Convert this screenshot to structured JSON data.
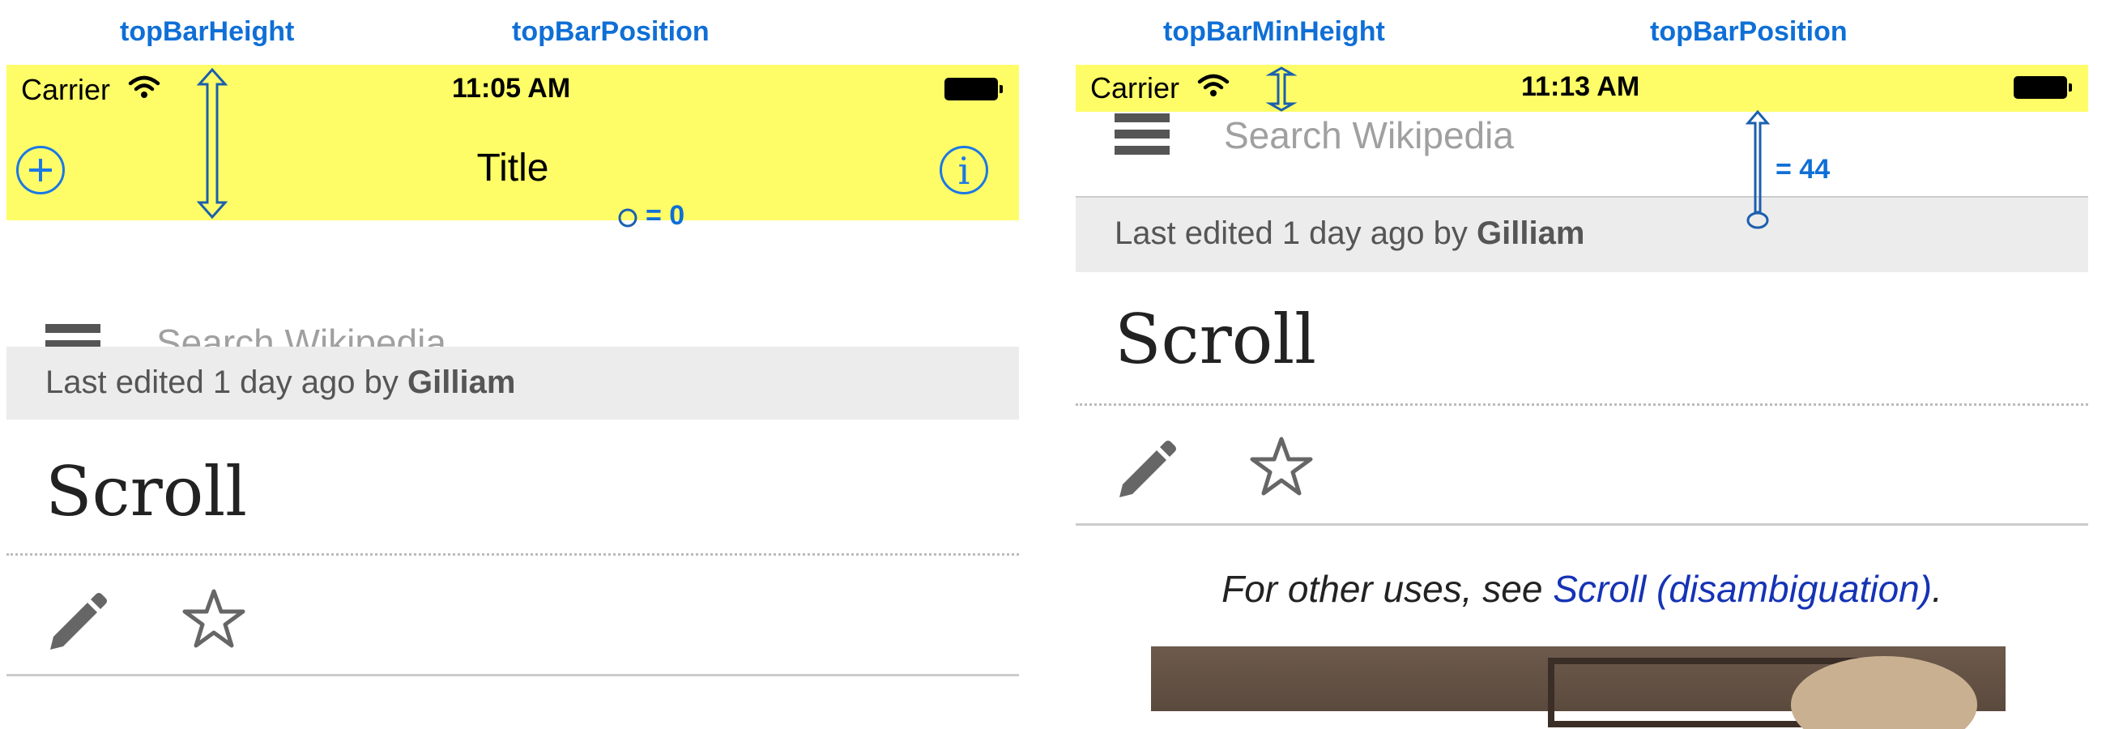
{
  "annotations": {
    "left": {
      "label_height": "topBarHeight",
      "label_position": "topBarPosition",
      "position_value": "= 0"
    },
    "right": {
      "label_height": "topBarMinHeight",
      "label_position": "topBarPosition",
      "position_value": "= 44"
    }
  },
  "colors": {
    "top_bar": "#fefd67",
    "annotation": "#0f6fd6",
    "nav_icon": "#1b78e6",
    "link": "#1533b5",
    "last_edited_bg": "#ececec"
  },
  "left_screen": {
    "status": {
      "carrier": "Carrier",
      "time": "11:05 AM",
      "wifi_icon": "wifi-icon",
      "battery_icon": "battery-icon"
    },
    "nav": {
      "title": "Title",
      "left_icon": "plus-circle-icon",
      "right_icon": "info-circle-icon"
    },
    "search": {
      "menu_icon": "hamburger-icon",
      "placeholder": "Search Wikipedia"
    },
    "last_edited": {
      "prefix": "Last edited 1 day ago by",
      "user": "Gilliam"
    },
    "page_title": "Scroll",
    "actions": {
      "edit_icon": "pencil-icon",
      "star_icon": "star-icon"
    }
  },
  "right_screen": {
    "status": {
      "carrier": "Carrier",
      "time": "11:13 AM",
      "wifi_icon": "wifi-icon",
      "battery_icon": "battery-icon"
    },
    "search": {
      "menu_icon": "hamburger-icon",
      "placeholder": "Search Wikipedia"
    },
    "last_edited": {
      "prefix": "Last edited 1 day ago by",
      "user": "Gilliam"
    },
    "page_title": "Scroll",
    "actions": {
      "edit_icon": "pencil-icon",
      "star_icon": "star-icon"
    },
    "hatnote": {
      "prefix": "For other uses, see",
      "link": "Scroll (disambiguation)",
      "suffix": "."
    }
  }
}
